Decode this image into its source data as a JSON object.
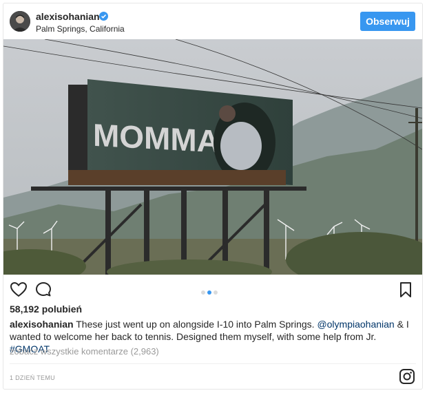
{
  "header": {
    "username": "alexisohanian",
    "location": "Palm Springs, California",
    "follow_label": "Obserwuj",
    "verified_badge": "verified-badge-icon"
  },
  "post": {
    "billboard_text": "MOMMA",
    "carousel": {
      "count": 3,
      "active_index": 1
    }
  },
  "engagement": {
    "likes": "58,192 polubień"
  },
  "caption": {
    "username": "alexisohanian",
    "text_part1": "These just went up on alongside I-10 into Palm Springs.",
    "mention": "@olympiaohanian",
    "text_part2": "& I wanted to welcome her back to tennis. Designed them myself, with some help from Jr.",
    "hashtag": "#GMOAT"
  },
  "comments": {
    "view_all": "zobacz wszystkie komentarze (2,963)"
  },
  "footer": {
    "timestamp": "1 DZIEŃ TEMU",
    "logo": "instagram-logo-icon"
  },
  "colors": {
    "accent": "#3897f0",
    "link": "#003569",
    "muted": "#999999",
    "text": "#262626"
  }
}
